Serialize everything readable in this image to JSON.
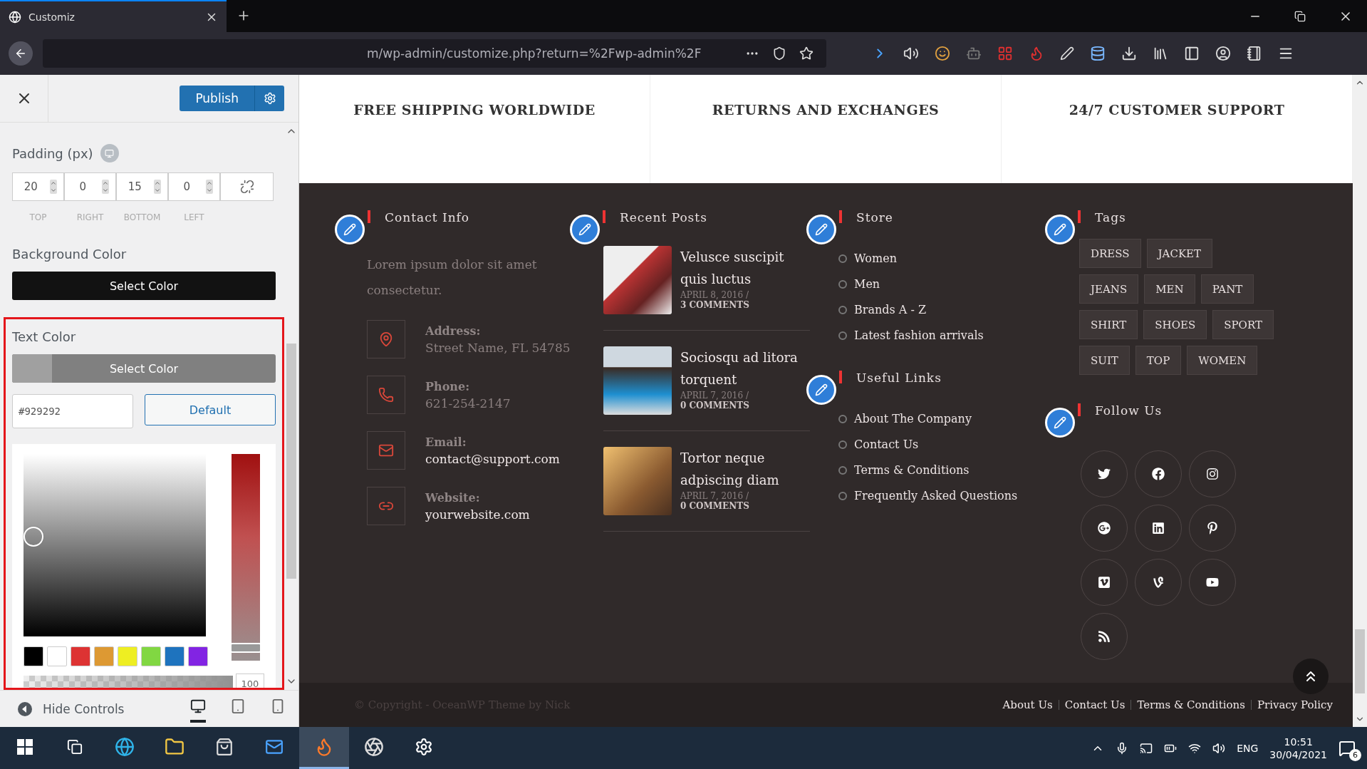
{
  "browser": {
    "tab": {
      "title": "Customiz"
    },
    "address": "m/wp-admin/customize.php?return=%2Fwp-admin%2F"
  },
  "customizer": {
    "publish": "Publish",
    "padding": {
      "label": "Padding (px)",
      "fields": [
        {
          "value": "20",
          "caption": "TOP"
        },
        {
          "value": "0",
          "caption": "RIGHT"
        },
        {
          "value": "15",
          "caption": "BOTTOM"
        },
        {
          "value": "0",
          "caption": "LEFT"
        }
      ]
    },
    "background_color": {
      "label": "Background Color",
      "button": "Select Color",
      "color": "#121212"
    },
    "text_color": {
      "label": "Text Color",
      "button": "Select Color",
      "color": "#808080",
      "hex": "#929292",
      "default": "Default",
      "opacity": "100",
      "hue_slider": {
        "level": 0.03
      },
      "opacity_slider": {
        "level": 1
      },
      "swatches": [
        {
          "color": "#000000"
        },
        {
          "color": "#ffffff"
        },
        {
          "color": "#dd3333"
        },
        {
          "color": "#dd9933"
        },
        {
          "color": "#eeee22"
        },
        {
          "color": "#81d742"
        },
        {
          "color": "#1e73be"
        },
        {
          "color": "#8224e3"
        }
      ]
    },
    "hide_controls": "Hide Controls",
    "devices": [
      {
        "kind": "desktop",
        "selected": true
      },
      {
        "kind": "tablet",
        "selected": false
      },
      {
        "kind": "mobile",
        "selected": false
      }
    ]
  },
  "features": [
    "FREE SHIPPING WORLDWIDE",
    "RETURNS AND EXCHANGES",
    "24/7 CUSTOMER SUPPORT"
  ],
  "footer": {
    "contact": {
      "title": "Contact Info",
      "intro": "Lorem ipsum dolor sit amet consectetur.",
      "items": [
        {
          "kind": "address",
          "label": "Address:",
          "value": "Street Name, FL 54785",
          "link": false
        },
        {
          "kind": "phone",
          "label": "Phone:",
          "value": "621-254-2147",
          "link": false
        },
        {
          "kind": "email",
          "label": "Email:",
          "value": "contact@support.com",
          "link": true
        },
        {
          "kind": "website",
          "label": "Website:",
          "value": "yourwebsite.com",
          "link": true
        }
      ]
    },
    "recent_posts": {
      "title": "Recent Posts",
      "posts": [
        {
          "title": "Velusce suscipit quis luctus",
          "date": "APRIL 8, 2016 /",
          "comments": "3 COMMENTS"
        },
        {
          "title": "Sociosqu ad litora torquent",
          "date": "APRIL 7, 2016 /",
          "comments": "0 COMMENTS"
        },
        {
          "title": "Tortor neque adpiscing diam",
          "date": "APRIL 7, 2016 /",
          "comments": "0 COMMENTS"
        }
      ]
    },
    "store": {
      "title": "Store",
      "links": [
        "Women",
        "Men",
        "Brands A - Z",
        "Latest fashion arrivals"
      ]
    },
    "useful_links": {
      "title": "Useful Links",
      "links": [
        "About The Company",
        "Contact Us",
        "Terms & Conditions",
        "Frequently Asked Questions"
      ]
    },
    "tags": {
      "title": "Tags",
      "items": [
        "DRESS",
        "JACKET",
        "JEANS",
        "MEN",
        "PANT",
        "SHIRT",
        "SHOES",
        "SPORT",
        "SUIT",
        "TOP",
        "WOMEN"
      ]
    },
    "follow": {
      "title": "Follow Us",
      "networks": [
        {
          "kind": "twitter"
        },
        {
          "kind": "facebook"
        },
        {
          "kind": "instagram"
        },
        {
          "kind": "google"
        },
        {
          "kind": "linkedin"
        },
        {
          "kind": "pinterest"
        },
        {
          "kind": "vimeo"
        },
        {
          "kind": "vine"
        },
        {
          "kind": "youtube"
        },
        {
          "kind": "rss"
        }
      ]
    }
  },
  "bottom_bar": {
    "copyright": "© Copyright - OceanWP Theme by Nick",
    "links": [
      "About Us",
      "Contact Us",
      "Terms & Conditions",
      "Privacy Policy"
    ]
  },
  "taskbar": {
    "language": "ENG",
    "time": "10:51",
    "date": "30/04/2021",
    "notifications": "6"
  }
}
